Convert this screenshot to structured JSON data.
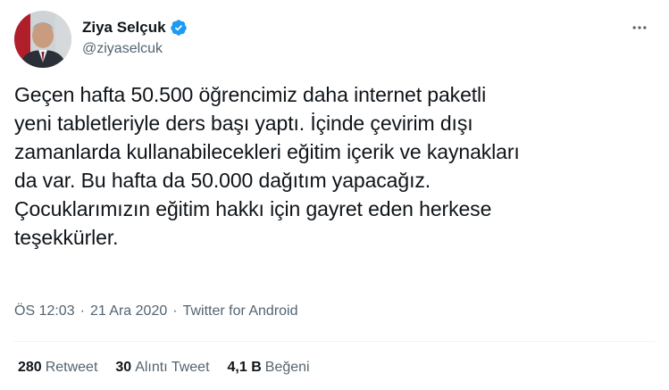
{
  "author": {
    "display_name": "Ziya Selçuk",
    "handle": "@ziyaselcuk",
    "avatar": "avatar-photo",
    "verified_icon": "verified-badge-icon"
  },
  "tweet": {
    "text": "Geçen hafta 50.500 öğrencimiz daha internet paketli\nyeni tabletleriyle ders başı yaptı. İçinde çevirim dışı\nzamanlarda kullanabilecekleri eğitim içerik ve kaynakları\nda var. Bu hafta da 50.000 dağıtım yapacağız.\nÇocuklarımızın eğitim hakkı için gayret eden herkese\nteşekkürler."
  },
  "meta": {
    "time": "ÖS 12:03",
    "separator": "·",
    "date": "21 Ara 2020",
    "source": "Twitter for Android"
  },
  "stats": {
    "retweets_count": "280",
    "retweets_label": "Retweet",
    "quotes_count": "30",
    "quotes_label": "Alıntı Tweet",
    "likes_count": "4,1 B",
    "likes_label": "Beğeni"
  },
  "icons": {
    "more": "more-options-icon"
  },
  "colors": {
    "verified": "#1d9bf0",
    "secondary_text": "#536471",
    "primary_text": "#0f1419"
  }
}
